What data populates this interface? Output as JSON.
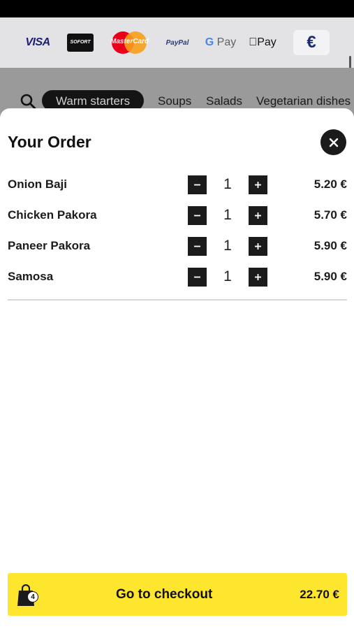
{
  "payment_methods": [
    {
      "name": "visa-logo",
      "label": "VISA"
    },
    {
      "name": "sofort-logo",
      "label": "SOFORT"
    },
    {
      "name": "mastercard-logo",
      "label": "MasterCard"
    },
    {
      "name": "paypal-logo",
      "label": "PayPal"
    },
    {
      "name": "gpay-logo",
      "label": "Pay"
    },
    {
      "name": "applepay-logo",
      "label": "Pay"
    },
    {
      "name": "euro-icon",
      "label": "€"
    }
  ],
  "categories": {
    "active": "Warm starters",
    "items": [
      "Soups",
      "Salads",
      "Vegetarian dishes"
    ]
  },
  "order": {
    "title": "Your Order",
    "items": [
      {
        "name": "Onion Baji",
        "qty": "1",
        "price": "5.20 €"
      },
      {
        "name": "Chicken Pakora",
        "qty": "1",
        "price": "5.70 €"
      },
      {
        "name": "Paneer Pakora",
        "qty": "1",
        "price": "5.90 €"
      },
      {
        "name": "Samosa",
        "qty": "1",
        "price": "5.90 €"
      }
    ]
  },
  "checkout": {
    "label": "Go to checkout",
    "total": "22.70 €",
    "bag_count": "4"
  },
  "colors": {
    "accent": "#ffe62e",
    "dark": "#1b1b1b"
  },
  "icons": [
    "search-icon",
    "close-icon",
    "minus-icon",
    "plus-icon",
    "shopping-bag-icon"
  ]
}
